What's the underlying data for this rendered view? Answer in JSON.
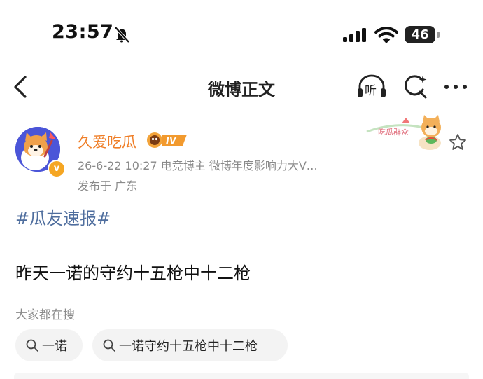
{
  "status_bar": {
    "time": "23:57",
    "battery_level": "46",
    "icons": [
      "bell-muted-icon",
      "cellular-signal-icon",
      "wifi-icon",
      "battery-icon"
    ]
  },
  "nav": {
    "title": "微博正文",
    "listen_label": "听",
    "icons": [
      "back-arrow-icon",
      "listen-headphones-icon",
      "search-icon",
      "more-icon"
    ]
  },
  "post": {
    "username": "久爱吃瓜",
    "medal_text": "IV",
    "meta": "26-6-22 10:27  电竞博主 微博年度影响力大V…",
    "location": "发布于 广东",
    "sticker_text": "吃瓜群众",
    "topic": "#瓜友速报#",
    "content": "昨天一诺的守约十五枪中十二枪"
  },
  "search_suggestions": {
    "hint": "大家都在搜",
    "chips": [
      {
        "label": "一诺"
      },
      {
        "label": "一诺守约十五枪中十二枪"
      }
    ]
  },
  "colors": {
    "username": "#ef7e27",
    "topic": "#4f6e9e",
    "meta": "#8a8a8a",
    "chip_bg": "#f3f3f3",
    "avatar_bg": "#4b55d8",
    "verified_badge": "#f5a623"
  }
}
